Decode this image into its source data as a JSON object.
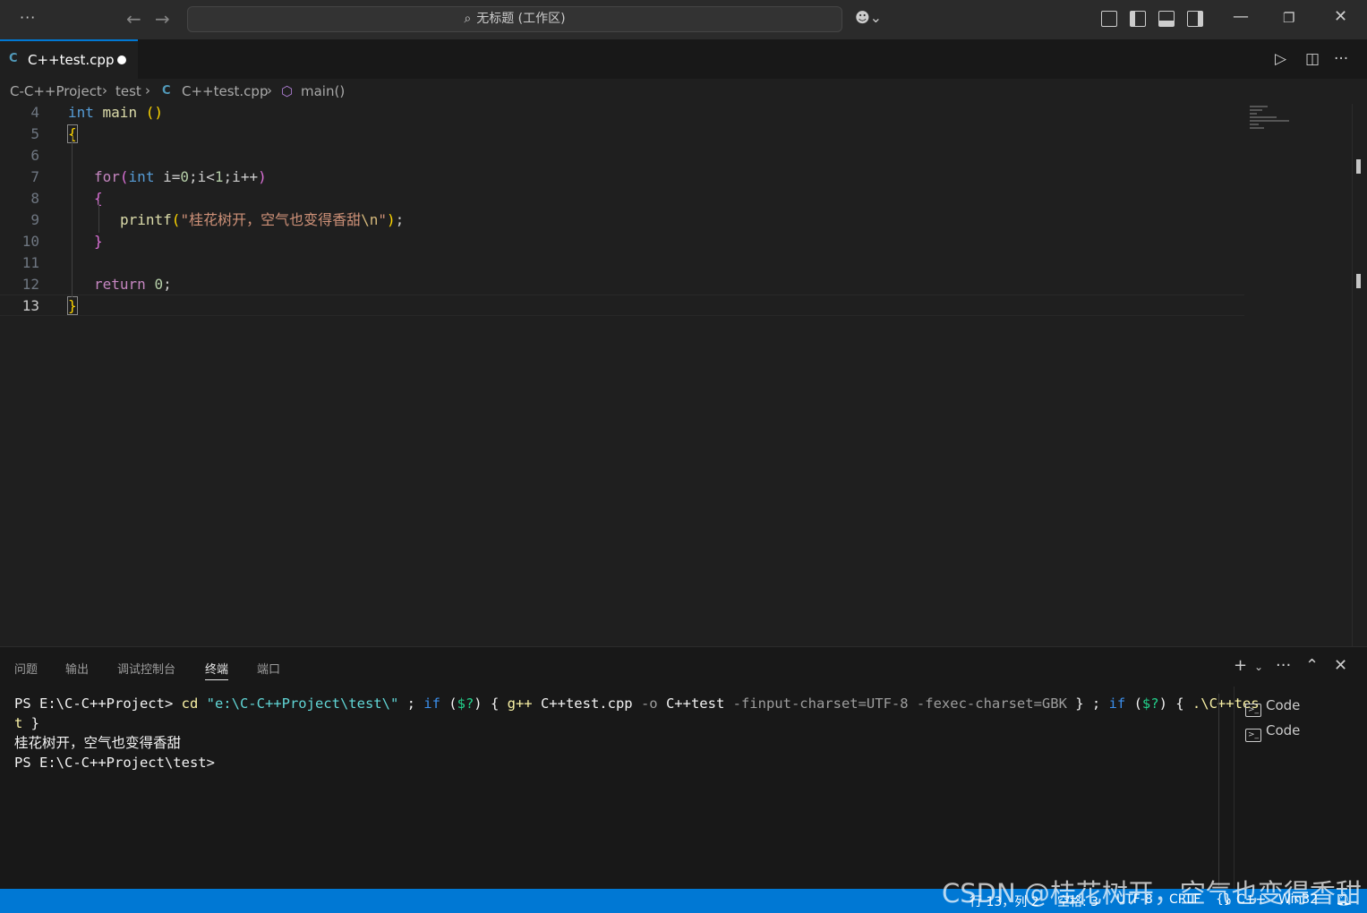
{
  "titlebar": {
    "search_text": "无标题 (工作区)"
  },
  "tab": {
    "icon_text": "C",
    "label": "C++test.cpp"
  },
  "breadcrumb": {
    "items": [
      "C-C++Project",
      "test",
      "C++test.cpp",
      "main()"
    ]
  },
  "editor": {
    "line_numbers": [
      "4",
      "5",
      "6",
      "7",
      "8",
      "9",
      "10",
      "11",
      "12",
      "13"
    ],
    "code": {
      "l4_kw": "int",
      "l4_fn": " main ",
      "l4_paren": "()",
      "l5": "{",
      "l7_for": "for",
      "l7_paren_open": "(",
      "l7_int": "int",
      "l7_rest_a": " i=",
      "l7_num0": "0",
      "l7_rest_b": ";i<",
      "l7_num1": "1",
      "l7_rest_c": ";i++",
      "l7_paren_close": ")",
      "l8": "{",
      "l9_fn": "printf",
      "l9_paren_open": "(",
      "l9_str": "\"桂花树开，空气也变得香甜",
      "l9_esc": "\\n",
      "l9_str_end": "\"",
      "l9_paren_close": ")",
      "l9_semi": ";",
      "l10": "}",
      "l12_kw": "return",
      "l12_num": "0",
      "l12_semi": ";",
      "l13": "}"
    }
  },
  "panel": {
    "tabs": [
      "问题",
      "输出",
      "调试控制台",
      "终端",
      "端口"
    ],
    "active_tab": "终端",
    "terminal": {
      "line1_prompt": "PS E:\\C-C++Project> ",
      "line1_cd": "cd",
      "line1_path": " \"e:\\C-C++Project\\test\\\"",
      "line1_a": " ; ",
      "line1_if1": "if",
      "line1_b": " (",
      "line1_q1": "$?",
      "line1_c": ") { ",
      "line1_gpp": "g++",
      "line1_d": " C++test.cpp ",
      "line1_o": "-o",
      "line1_e": " C++test ",
      "line1_flags": "-finput-charset=UTF-8 -fexec-charset=GBK",
      "line1_f": " } ; ",
      "line1_if2": "if",
      "line1_g": " (",
      "line1_q2": "$?",
      "line1_h": ") { ",
      "line1_run": ".\\C++tes",
      "line2_run": "t",
      "line2_end": " }",
      "line3": "桂花树开，空气也变得香甜",
      "line4": "PS E:\\C-C++Project\\test>"
    },
    "terminal_list": [
      "Code",
      "Code"
    ]
  },
  "statusbar": {
    "position": "行 13，列 2",
    "spaces": "空格: 3",
    "encoding": "UTF-8",
    "eol": "CRLF",
    "language": "C++",
    "platform": "Win32"
  },
  "watermark": "CSDN @桂花树开，空气也变得香甜",
  "colors": {
    "accent": "#0078d4",
    "editor_bg": "#1f1f1f",
    "panel_bg": "#181818"
  }
}
